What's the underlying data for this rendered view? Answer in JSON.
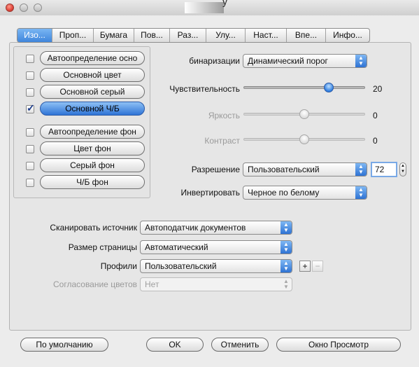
{
  "tabs": [
    {
      "label": "Изо...",
      "active": true
    },
    {
      "label": "Проп..."
    },
    {
      "label": "Бумага"
    },
    {
      "label": "Пов..."
    },
    {
      "label": "Раз..."
    },
    {
      "label": "Улу..."
    },
    {
      "label": "Наст..."
    },
    {
      "label": "Впе..."
    },
    {
      "label": "Инфо..."
    }
  ],
  "image_types": [
    {
      "label": "Автоопределение осно",
      "checked": false
    },
    {
      "label": "Основной цвет",
      "checked": false
    },
    {
      "label": "Основной серый",
      "checked": false
    },
    {
      "label": "Основной Ч/Б",
      "checked": true,
      "selected": true
    },
    {
      "label": "Автоопределение фон",
      "checked": false
    },
    {
      "label": "Цвет фон",
      "checked": false
    },
    {
      "label": "Серый фон",
      "checked": false
    },
    {
      "label": "Ч/Б фон",
      "checked": false
    }
  ],
  "binarization": {
    "label": "бинаризации",
    "value": "Динамический порог"
  },
  "sensitivity": {
    "label": "Чувствительность",
    "value": "20",
    "level": 0.72
  },
  "brightness": {
    "label": "Яркость",
    "value": "0",
    "level": 0.5
  },
  "contrast": {
    "label": "Контраст",
    "value": "0",
    "level": 0.5
  },
  "resolution": {
    "label": "Разрешение",
    "value": "Пользовательский",
    "dpi": "72"
  },
  "invert": {
    "label": "Инвертировать",
    "value": "Черное по белому"
  },
  "scan_source": {
    "label": "Сканировать источник",
    "value": "Автоподатчик документов"
  },
  "page_size": {
    "label": "Размер страницы",
    "value": "Автоматический"
  },
  "profiles": {
    "label": "Профили",
    "value": "Пользовательский",
    "add": "+",
    "remove": "−"
  },
  "color_matching": {
    "label": "Согласование цветов",
    "value": "Нет"
  },
  "buttons": {
    "default": "По умолчанию",
    "ok": "OK",
    "cancel": "Отменить",
    "preview": "Окно Просмотр"
  },
  "colors": {
    "accent": "#3f86dc",
    "window_bg": "#ececec"
  }
}
